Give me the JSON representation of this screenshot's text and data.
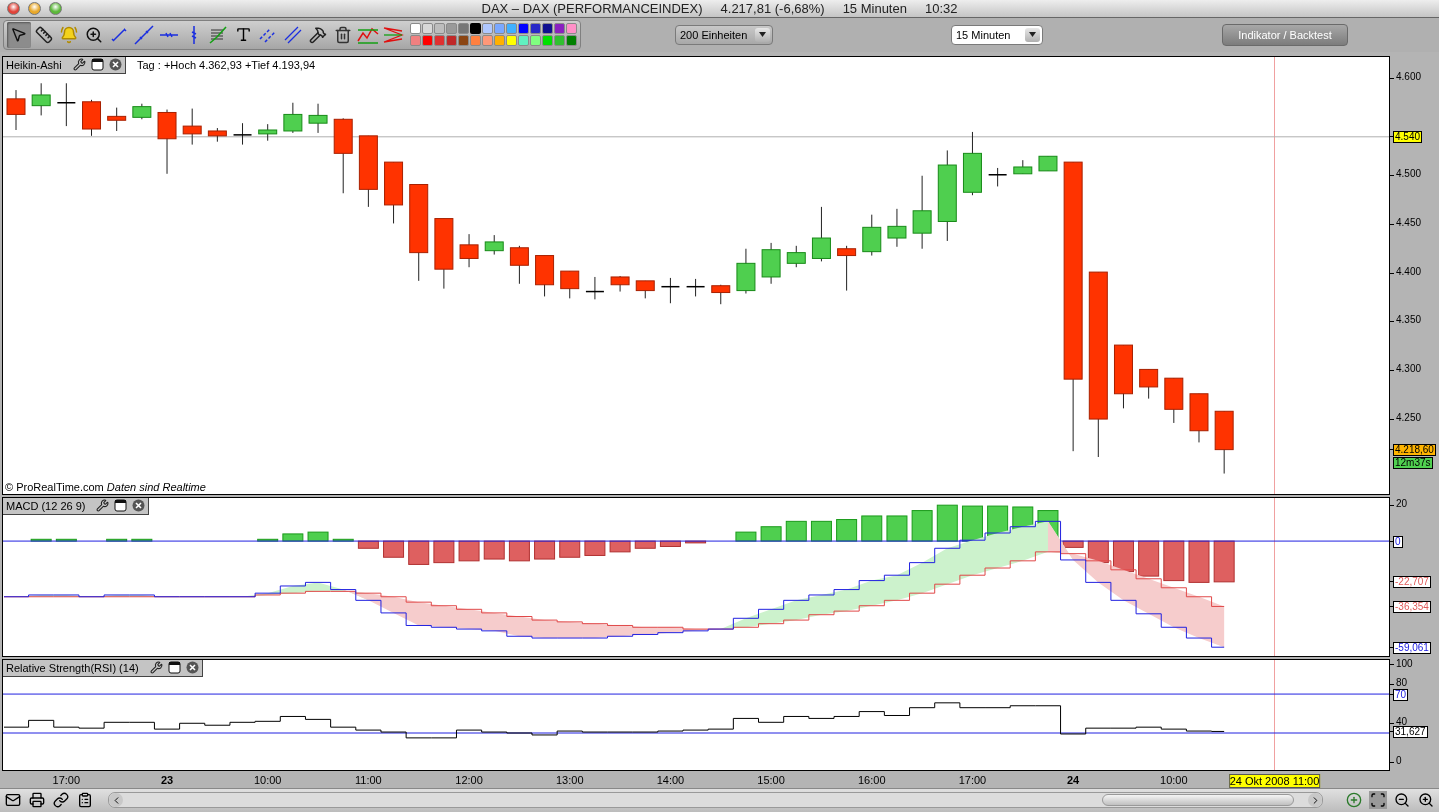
{
  "window": {
    "title": "DAX – DAX (PERFORMANCEINDEX)",
    "price": "4.217,81 (-6,68%)",
    "interval": "15 Minuten",
    "time": "10:32"
  },
  "toolbar": {
    "tools": [
      {
        "kind": "pointer",
        "selected": true
      },
      {
        "kind": "ruler",
        "selected": false
      },
      {
        "kind": "alert",
        "selected": false
      },
      {
        "kind": "zoom",
        "selected": false
      },
      {
        "kind": "segment",
        "selected": false
      },
      {
        "kind": "line",
        "selected": false
      },
      {
        "kind": "hline",
        "selected": false
      },
      {
        "kind": "vline",
        "selected": false
      },
      {
        "kind": "fib",
        "selected": false
      },
      {
        "kind": "text",
        "selected": false
      },
      {
        "kind": "channel",
        "selected": false
      },
      {
        "kind": "parallel",
        "selected": false
      },
      {
        "kind": "tools",
        "selected": false
      },
      {
        "kind": "trash",
        "selected": false
      },
      {
        "kind": "wave",
        "selected": false
      },
      {
        "kind": "fan",
        "selected": false
      }
    ],
    "colors": [
      {
        "color": "#ffffff",
        "selected": false
      },
      {
        "color": "#d8d8d8",
        "selected": false
      },
      {
        "color": "#bdbdbd",
        "selected": false
      },
      {
        "color": "#9a9a9a",
        "selected": false
      },
      {
        "color": "#777777",
        "selected": false
      },
      {
        "color": "#000000",
        "selected": true
      },
      {
        "color": "#b0c8ff",
        "selected": false
      },
      {
        "color": "#7aa8ff",
        "selected": false
      },
      {
        "color": "#40b0ff",
        "selected": false
      },
      {
        "color": "#0000ff",
        "selected": false
      },
      {
        "color": "#2828c8",
        "selected": false
      },
      {
        "color": "#101090",
        "selected": false
      },
      {
        "color": "#8a20c0",
        "selected": false
      },
      {
        "color": "#ff90c8",
        "selected": false
      },
      {
        "color": "#f08080",
        "selected": false
      },
      {
        "color": "#ff0000",
        "selected": false
      },
      {
        "color": "#e03030",
        "selected": false
      },
      {
        "color": "#c02828",
        "selected": false
      },
      {
        "color": "#8b4513",
        "selected": false
      },
      {
        "color": "#ff8040",
        "selected": false
      },
      {
        "color": "#ff9878",
        "selected": false
      },
      {
        "color": "#ffb000",
        "selected": false
      },
      {
        "color": "#ffff00",
        "selected": false
      },
      {
        "color": "#60f0c0",
        "selected": false
      },
      {
        "color": "#80ff80",
        "selected": false
      },
      {
        "color": "#00e000",
        "selected": false
      },
      {
        "color": "#30c030",
        "selected": false
      },
      {
        "color": "#008000",
        "selected": false
      }
    ],
    "units": {
      "value": "200 Einheiten"
    },
    "interval": {
      "value": "15 Minuten"
    },
    "action": "Indikator / Backtest"
  },
  "price_pane": {
    "title": "Heikin-Ashi",
    "info": "Tag : +Hoch 4.362,93 +Tief 4.193,94",
    "footer": "© ProRealTime.com  *Daten sind Realtime*",
    "timer": "12m37s",
    "axis": [
      {
        "text": "4.600",
        "kind": "tick"
      },
      {
        "text": "4.540",
        "kind": "level"
      },
      {
        "text": "4.500",
        "kind": "tick"
      },
      {
        "text": "4.450",
        "kind": "tick"
      },
      {
        "text": "4.400",
        "kind": "tick"
      },
      {
        "text": "4.350",
        "kind": "tick"
      },
      {
        "text": "4.300",
        "kind": "tick"
      },
      {
        "text": "4.250",
        "kind": "tick"
      },
      {
        "text": "4.218,60",
        "kind": "last"
      }
    ]
  },
  "macd_pane": {
    "title": "MACD (12 26 9)",
    "axis": [
      {
        "text": "20",
        "kind": "tick"
      },
      {
        "text": "0",
        "kind": "zero"
      },
      {
        "text": "-22,707",
        "kind": "histogram"
      },
      {
        "text": "-36,354",
        "kind": "signal"
      },
      {
        "text": "-59,061",
        "kind": "macd"
      }
    ]
  },
  "rsi_pane": {
    "title": "Relative Strength(RSI) (14)",
    "axis": [
      {
        "text": "100",
        "kind": "tick"
      },
      {
        "text": "80",
        "kind": "tick"
      },
      {
        "text": "70",
        "kind": "level"
      },
      {
        "text": "40",
        "kind": "tick"
      },
      {
        "text": "31,627",
        "kind": "last"
      },
      {
        "text": "0",
        "kind": "tick"
      }
    ]
  },
  "time_axis": [
    {
      "text": "17:00",
      "kind": "time"
    },
    {
      "text": "23",
      "kind": "day"
    },
    {
      "text": "10:00",
      "kind": "time"
    },
    {
      "text": "11:00",
      "kind": "time"
    },
    {
      "text": "12:00",
      "kind": "time"
    },
    {
      "text": "13:00",
      "kind": "time"
    },
    {
      "text": "14:00",
      "kind": "time"
    },
    {
      "text": "15:00",
      "kind": "time"
    },
    {
      "text": "16:00",
      "kind": "time"
    },
    {
      "text": "17:00",
      "kind": "time"
    },
    {
      "text": "24",
      "kind": "day"
    },
    {
      "text": "10:00",
      "kind": "time"
    },
    {
      "text": "24 Okt 2008 11:00",
      "kind": "cursor"
    }
  ]
}
